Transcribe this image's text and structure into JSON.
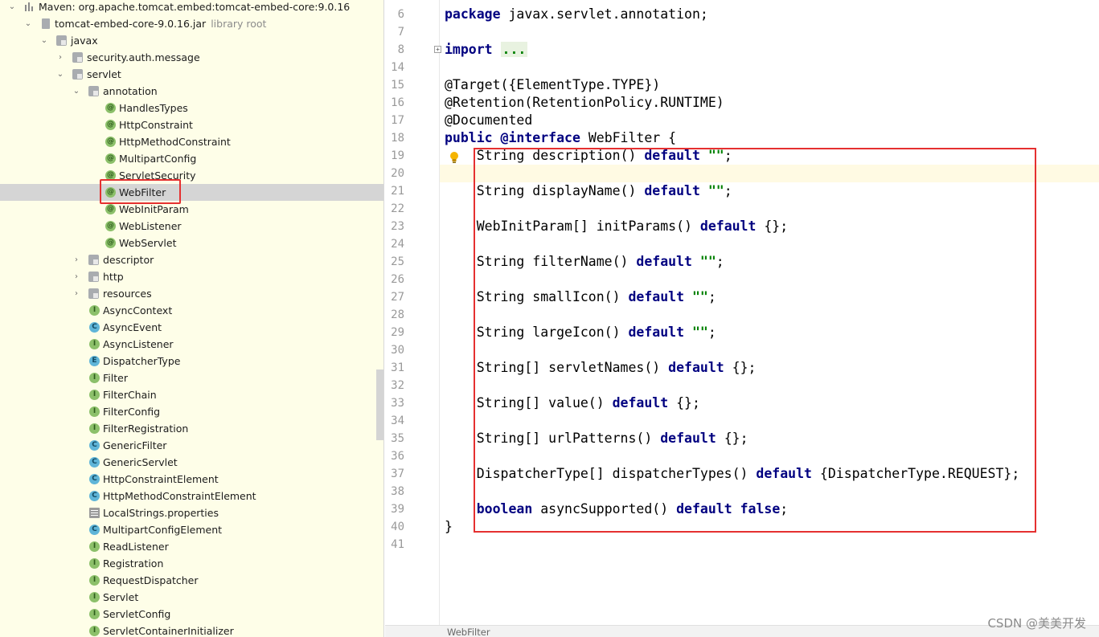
{
  "tree": {
    "root": {
      "label": "Maven: org.apache.tomcat.embed:tomcat-embed-core:9.0.16"
    },
    "jar": {
      "label": "tomcat-embed-core-9.0.16.jar",
      "note": "library root"
    },
    "packages": {
      "javax": "javax",
      "security": "security.auth.message",
      "servlet": "servlet",
      "annotation": "annotation",
      "descriptor": "descriptor",
      "http": "http",
      "resources": "resources"
    },
    "annotation_items": [
      "HandlesTypes",
      "HttpConstraint",
      "HttpMethodConstraint",
      "MultipartConfig",
      "ServletSecurity",
      "WebFilter",
      "WebInitParam",
      "WebListener",
      "WebServlet"
    ],
    "servlet_items": [
      {
        "label": "AsyncContext",
        "icon": "I"
      },
      {
        "label": "AsyncEvent",
        "icon": "C"
      },
      {
        "label": "AsyncListener",
        "icon": "I"
      },
      {
        "label": "DispatcherType",
        "icon": "E"
      },
      {
        "label": "Filter",
        "icon": "I"
      },
      {
        "label": "FilterChain",
        "icon": "I"
      },
      {
        "label": "FilterConfig",
        "icon": "I"
      },
      {
        "label": "FilterRegistration",
        "icon": "I"
      },
      {
        "label": "GenericFilter",
        "icon": "C"
      },
      {
        "label": "GenericServlet",
        "icon": "C"
      },
      {
        "label": "HttpConstraintElement",
        "icon": "C"
      },
      {
        "label": "HttpMethodConstraintElement",
        "icon": "C"
      },
      {
        "label": "LocalStrings.properties",
        "icon": "P"
      },
      {
        "label": "MultipartConfigElement",
        "icon": "C"
      },
      {
        "label": "ReadListener",
        "icon": "I"
      },
      {
        "label": "Registration",
        "icon": "I"
      },
      {
        "label": "RequestDispatcher",
        "icon": "I"
      },
      {
        "label": "Servlet",
        "icon": "I"
      },
      {
        "label": "ServletConfig",
        "icon": "I"
      },
      {
        "label": "ServletContainerInitializer",
        "icon": "I"
      }
    ],
    "selected": "WebFilter"
  },
  "editor": {
    "lines": [
      {
        "n": "6",
        "tokens": [
          [
            "kw",
            "package"
          ],
          [
            "",
            " javax.servlet.annotation;"
          ]
        ]
      },
      {
        "n": "7",
        "tokens": []
      },
      {
        "n": "8",
        "tokens": [
          [
            "kw",
            "import"
          ],
          [
            "",
            " "
          ],
          [
            "folded",
            "..."
          ]
        ]
      },
      {
        "n": "14",
        "tokens": []
      },
      {
        "n": "15",
        "tokens": [
          [
            "",
            "@Target({ElementType.TYPE})"
          ]
        ]
      },
      {
        "n": "16",
        "tokens": [
          [
            "",
            "@Retention(RetentionPolicy.RUNTIME)"
          ]
        ]
      },
      {
        "n": "17",
        "tokens": [
          [
            "",
            "@Documented"
          ]
        ]
      },
      {
        "n": "18",
        "tokens": [
          [
            "kw",
            "public"
          ],
          [
            "",
            " "
          ],
          [
            "kw",
            "@interface"
          ],
          [
            "",
            " WebFilter {"
          ]
        ]
      },
      {
        "n": "19",
        "tokens": [
          [
            "",
            "    String description() "
          ],
          [
            "kw",
            "default"
          ],
          [
            "",
            " "
          ],
          [
            "str",
            "\"\""
          ],
          [
            "",
            ";"
          ]
        ]
      },
      {
        "n": "20",
        "tokens": []
      },
      {
        "n": "21",
        "tokens": [
          [
            "",
            "    String displayName() "
          ],
          [
            "kw",
            "default"
          ],
          [
            "",
            " "
          ],
          [
            "str",
            "\"\""
          ],
          [
            "",
            ";"
          ]
        ]
      },
      {
        "n": "22",
        "tokens": []
      },
      {
        "n": "23",
        "tokens": [
          [
            "",
            "    WebInitParam[] initParams() "
          ],
          [
            "kw",
            "default"
          ],
          [
            "",
            " {};"
          ]
        ]
      },
      {
        "n": "24",
        "tokens": []
      },
      {
        "n": "25",
        "tokens": [
          [
            "",
            "    String filterName() "
          ],
          [
            "kw",
            "default"
          ],
          [
            "",
            " "
          ],
          [
            "str",
            "\"\""
          ],
          [
            "",
            ";"
          ]
        ]
      },
      {
        "n": "26",
        "tokens": []
      },
      {
        "n": "27",
        "tokens": [
          [
            "",
            "    String smallIcon() "
          ],
          [
            "kw",
            "default"
          ],
          [
            "",
            " "
          ],
          [
            "str",
            "\"\""
          ],
          [
            "",
            ";"
          ]
        ]
      },
      {
        "n": "28",
        "tokens": []
      },
      {
        "n": "29",
        "tokens": [
          [
            "",
            "    String largeIcon() "
          ],
          [
            "kw",
            "default"
          ],
          [
            "",
            " "
          ],
          [
            "str",
            "\"\""
          ],
          [
            "",
            ";"
          ]
        ]
      },
      {
        "n": "30",
        "tokens": []
      },
      {
        "n": "31",
        "tokens": [
          [
            "",
            "    String[] servletNames() "
          ],
          [
            "kw",
            "default"
          ],
          [
            "",
            " {};"
          ]
        ]
      },
      {
        "n": "32",
        "tokens": []
      },
      {
        "n": "33",
        "tokens": [
          [
            "",
            "    String[] value() "
          ],
          [
            "kw",
            "default"
          ],
          [
            "",
            " {};"
          ]
        ]
      },
      {
        "n": "34",
        "tokens": []
      },
      {
        "n": "35",
        "tokens": [
          [
            "",
            "    String[] urlPatterns() "
          ],
          [
            "kw",
            "default"
          ],
          [
            "",
            " {};"
          ]
        ]
      },
      {
        "n": "36",
        "tokens": []
      },
      {
        "n": "37",
        "tokens": [
          [
            "",
            "    DispatcherType[] dispatcherTypes() "
          ],
          [
            "kw",
            "default"
          ],
          [
            "",
            " {DispatcherType.REQUEST};"
          ]
        ]
      },
      {
        "n": "38",
        "tokens": []
      },
      {
        "n": "39",
        "tokens": [
          [
            "",
            "    "
          ],
          [
            "kw",
            "boolean"
          ],
          [
            "",
            " asyncSupported() "
          ],
          [
            "kw",
            "default"
          ],
          [
            "",
            " "
          ],
          [
            "kw",
            "false"
          ],
          [
            "",
            ";"
          ]
        ]
      },
      {
        "n": "40",
        "tokens": [
          [
            "",
            "}"
          ]
        ]
      },
      {
        "n": "41",
        "tokens": []
      }
    ]
  },
  "status": {
    "breadcrumb": "WebFilter"
  },
  "watermark": "CSDN @美美开发",
  "colors": {
    "highlight": "#e53030",
    "keyword": "#000080",
    "string": "#008000",
    "tree_bg": "#fefee8"
  }
}
